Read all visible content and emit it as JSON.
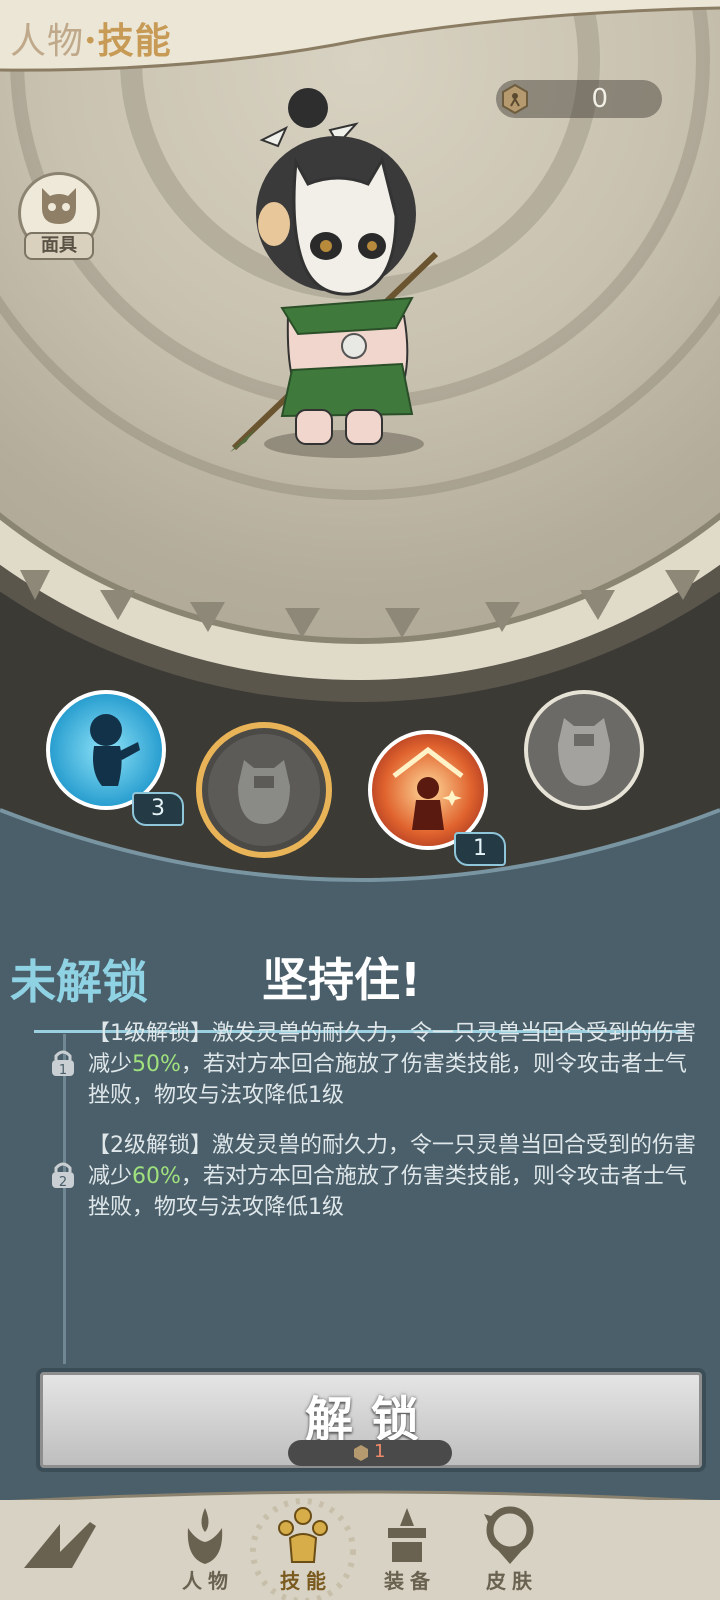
{
  "header": {
    "title_part1": "人物",
    "title_sep": "·",
    "title_part2": "技能"
  },
  "currency": {
    "icon": "token-coin-icon",
    "value": "0"
  },
  "mask_button": {
    "label": "面具",
    "icon": "mask-icon"
  },
  "skills": [
    {
      "name": "dash-skill",
      "level": "3",
      "unlocked": true
    },
    {
      "name": "endure-skill",
      "level": "",
      "unlocked": false,
      "selected": true
    },
    {
      "name": "shelter-skill",
      "level": "1",
      "unlocked": true
    },
    {
      "name": "locked-skill",
      "level": "",
      "unlocked": false
    }
  ],
  "detail": {
    "lock_state": "未解锁",
    "skill_name": "坚持住!",
    "levels": [
      {
        "badge": "1",
        "prefix": "【1级解锁】激发灵兽的耐久力，令一只灵兽当回合受到的伤害减少",
        "highlight": "50%",
        "suffix": "，若对方本回合施放了伤害类技能，则令攻击者士气挫败，物攻与法攻降低1级"
      },
      {
        "badge": "2",
        "prefix": "【2级解锁】激发灵兽的耐久力，令一只灵兽当回合受到的伤害减少",
        "highlight": "60%",
        "suffix": "，若对方本回合施放了伤害类技能，则令攻击者士气挫败，物攻与法攻降低1级"
      }
    ]
  },
  "unlock_button": {
    "label": "解锁",
    "cost": "1"
  },
  "nav": {
    "items": [
      {
        "label": "",
        "icon": "back-icon"
      },
      {
        "label": "人物",
        "icon": "character-icon"
      },
      {
        "label": "技能",
        "icon": "skill-icon",
        "active": true
      },
      {
        "label": "装备",
        "icon": "equipment-icon"
      },
      {
        "label": "皮肤",
        "icon": "skin-icon"
      }
    ]
  },
  "colors": {
    "panel": "#4a5f6a",
    "accent_cyan": "#8fd2e4",
    "highlight_green": "#9fe17d",
    "gold": "#c79a55"
  }
}
